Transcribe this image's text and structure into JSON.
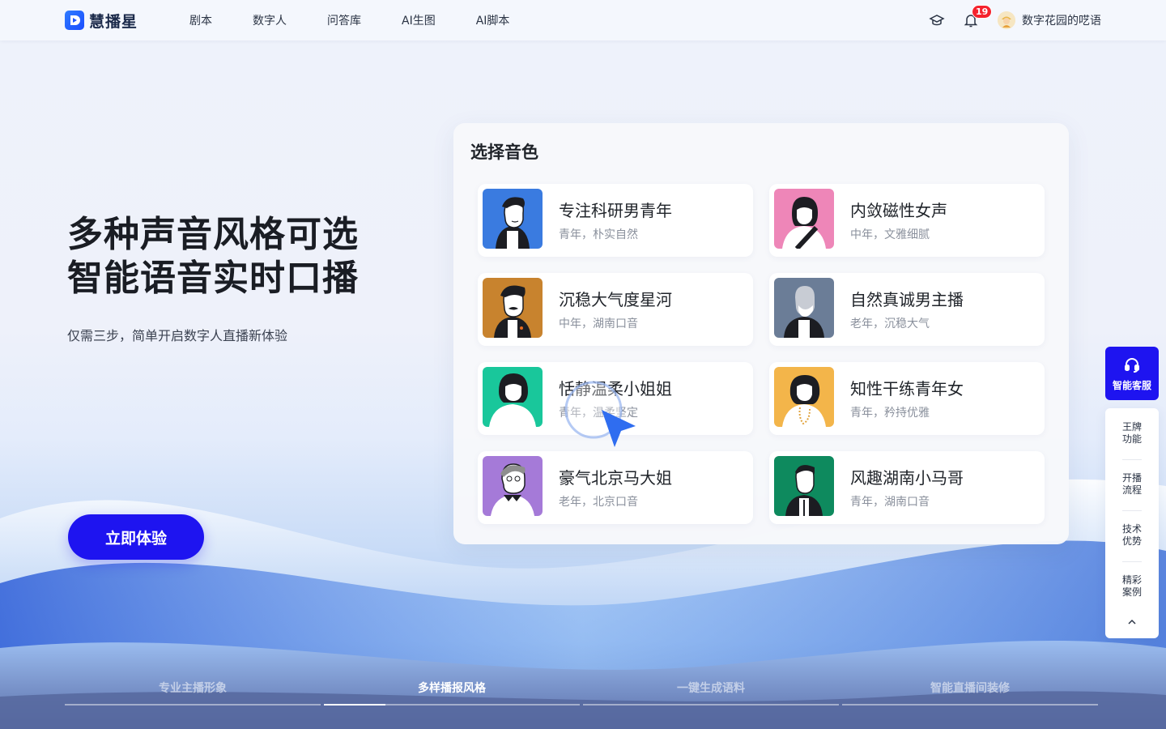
{
  "brand": {
    "name": "慧播星"
  },
  "nav": {
    "items": [
      "剧本",
      "数字人",
      "问答库",
      "AI生图",
      "AI脚本"
    ]
  },
  "header": {
    "notification_count": "19",
    "username": "数字花园的呓语"
  },
  "hero": {
    "title_line1": "多种声音风格可选",
    "title_line2": "智能语音实时口播",
    "subtitle": "仅需三步，简单开启数字人直播新体验",
    "cta_label": "立即体验"
  },
  "panel": {
    "title": "选择音色",
    "voices": [
      {
        "name": "专注科研男青年",
        "desc": "青年，朴实自然",
        "bg_color": "#3a7be0"
      },
      {
        "name": "内敛磁性女声",
        "desc": "中年，文雅细腻",
        "bg_color": "#ee86b8"
      },
      {
        "name": "沉稳大气度星河",
        "desc": "中年，湖南口音",
        "bg_color": "#c8832e"
      },
      {
        "name": "自然真诚男主播",
        "desc": "老年，沉稳大气",
        "bg_color": "#6b7d97"
      },
      {
        "name": "恬静温柔小姐姐",
        "desc": "青年，温柔坚定",
        "bg_color": "#19c79b"
      },
      {
        "name": "知性干练青年女",
        "desc": "青年，矜持优雅",
        "bg_color": "#f3b54a"
      },
      {
        "name": "豪气北京马大姐",
        "desc": "老年，北京口音",
        "bg_color": "#a57ad8"
      },
      {
        "name": "风趣湖南小马哥",
        "desc": "青年，湖南口音",
        "bg_color": "#0e8a5e"
      }
    ]
  },
  "sidebar": {
    "service_label": "智能客服",
    "items": [
      {
        "line1": "王牌",
        "line2": "功能"
      },
      {
        "line1": "开播",
        "line2": "流程"
      },
      {
        "line1": "技术",
        "line2": "优势"
      },
      {
        "line1": "精彩",
        "line2": "案例"
      }
    ]
  },
  "bottom_tabs": {
    "items": [
      "专业主播形象",
      "多样播报风格",
      "一键生成语料",
      "智能直播间装修"
    ],
    "active_index": 1,
    "active_progress": 0.24
  },
  "colors": {
    "accent": "#1e14f0",
    "badge": "#f5222d"
  }
}
